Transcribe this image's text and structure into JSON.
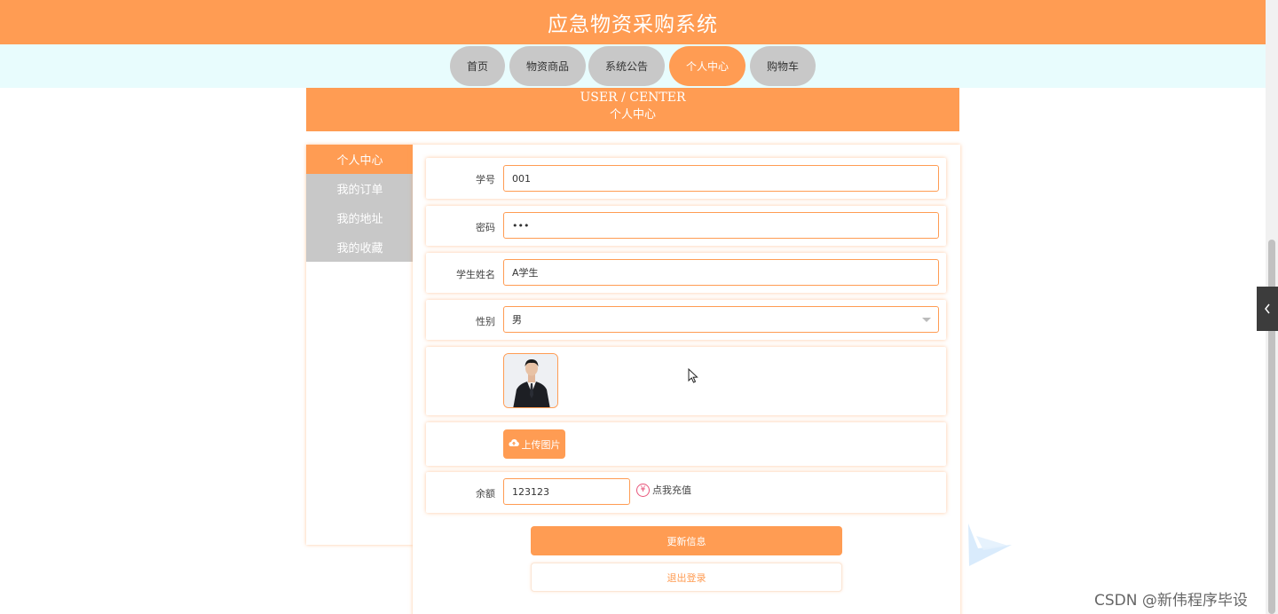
{
  "header": {
    "title": "应急物资采购系统"
  },
  "nav": {
    "items": [
      {
        "label": "首页"
      },
      {
        "label": "物资商品"
      },
      {
        "label": "系统公告"
      },
      {
        "label": "个人中心"
      },
      {
        "label": "购物车"
      }
    ],
    "active": "个人中心"
  },
  "banner": {
    "en_title": "USER / CENTER",
    "cn_title": "个人中心"
  },
  "sidebar": {
    "items": [
      {
        "label": "个人中心"
      },
      {
        "label": "我的订单"
      },
      {
        "label": "我的地址"
      },
      {
        "label": "我的收藏"
      }
    ],
    "active": "个人中心"
  },
  "form": {
    "student_id": {
      "label": "学号",
      "value": "001"
    },
    "password": {
      "label": "密码",
      "value": "•••"
    },
    "student_name": {
      "label": "学生姓名",
      "value": "A学生"
    },
    "gender": {
      "label": "性别",
      "value": "男"
    },
    "upload_label": "上传图片",
    "balance": {
      "label": "余额",
      "value": "123123"
    },
    "recharge_label": "点我充值",
    "update_label": "更新信息",
    "logout_label": "退出登录"
  },
  "icons": {
    "upload": "cloud-upload-icon",
    "recharge": "yen-icon",
    "select": "chevron-down-icon",
    "side_toggle": "chevron-left-icon"
  },
  "colors": {
    "accent": "#ff9c53",
    "nav_inactive": "#c8c8c8",
    "nav_background": "#e8fcfd",
    "recharge_icon": "#e8557a"
  },
  "watermark": "CSDN @新伟程序毕设"
}
